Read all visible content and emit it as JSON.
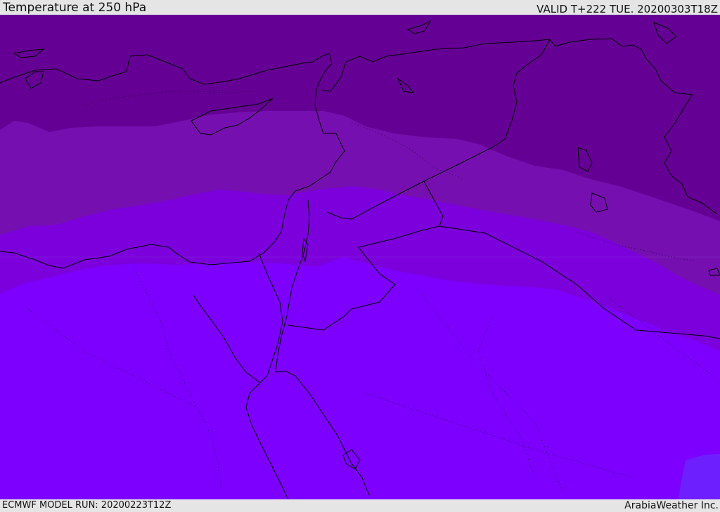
{
  "header": {
    "title": "Temperature at 250 hPa",
    "valid": "VALID T+222 TUE. 20200303T18Z"
  },
  "footer": {
    "model_run": "ECMWF MODEL RUN: 20200223T12Z",
    "credit": "ArabiaWeather Inc."
  },
  "map": {
    "colors": {
      "band_coldest": "#650095",
      "band_cold": "#760fb0",
      "band_mid": "#7b00dc",
      "band_warm": "#7d00fe",
      "band_warmest": "#6e1ffd",
      "coastline": "#000000"
    }
  }
}
